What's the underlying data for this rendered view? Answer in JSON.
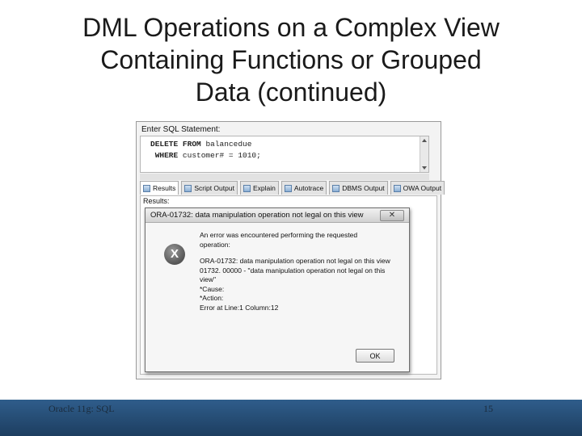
{
  "slide": {
    "title_lines": [
      "DML Operations on a Complex View",
      "Containing Functions or Grouped",
      "Data (continued)"
    ],
    "footer_left": "Oracle 11g: SQL",
    "page_number": "15"
  },
  "editor": {
    "label": "Enter SQL Statement:",
    "line1_kw1": "DELETE",
    "line1_kw2": "FROM",
    "line1_rest": "balancedue",
    "line2_kw": "WHERE",
    "line2_rest": "customer# = 1010;"
  },
  "tabs": [
    {
      "label": "Results",
      "active": true
    },
    {
      "label": "Script Output"
    },
    {
      "label": "Explain"
    },
    {
      "label": "Autotrace"
    },
    {
      "label": "DBMS Output"
    },
    {
      "label": "OWA Output"
    }
  ],
  "results": {
    "label": "Results:"
  },
  "dialog": {
    "title": "ORA-01732: data manipulation operation not legal on this view",
    "close_glyph": "✕",
    "icon_glyph": "X",
    "msg_line1": "An error was encountered performing the requested",
    "msg_line2": "operation:",
    "msg_line3": "ORA-01732: data manipulation operation not legal on this view",
    "msg_line4": "01732. 00000 - \"data manipulation operation not legal on this",
    "msg_line5": "view\"",
    "msg_line6": "*Cause:",
    "msg_line7": "*Action:",
    "msg_line8": "Error at Line:1 Column:12",
    "ok_label": "OK"
  }
}
